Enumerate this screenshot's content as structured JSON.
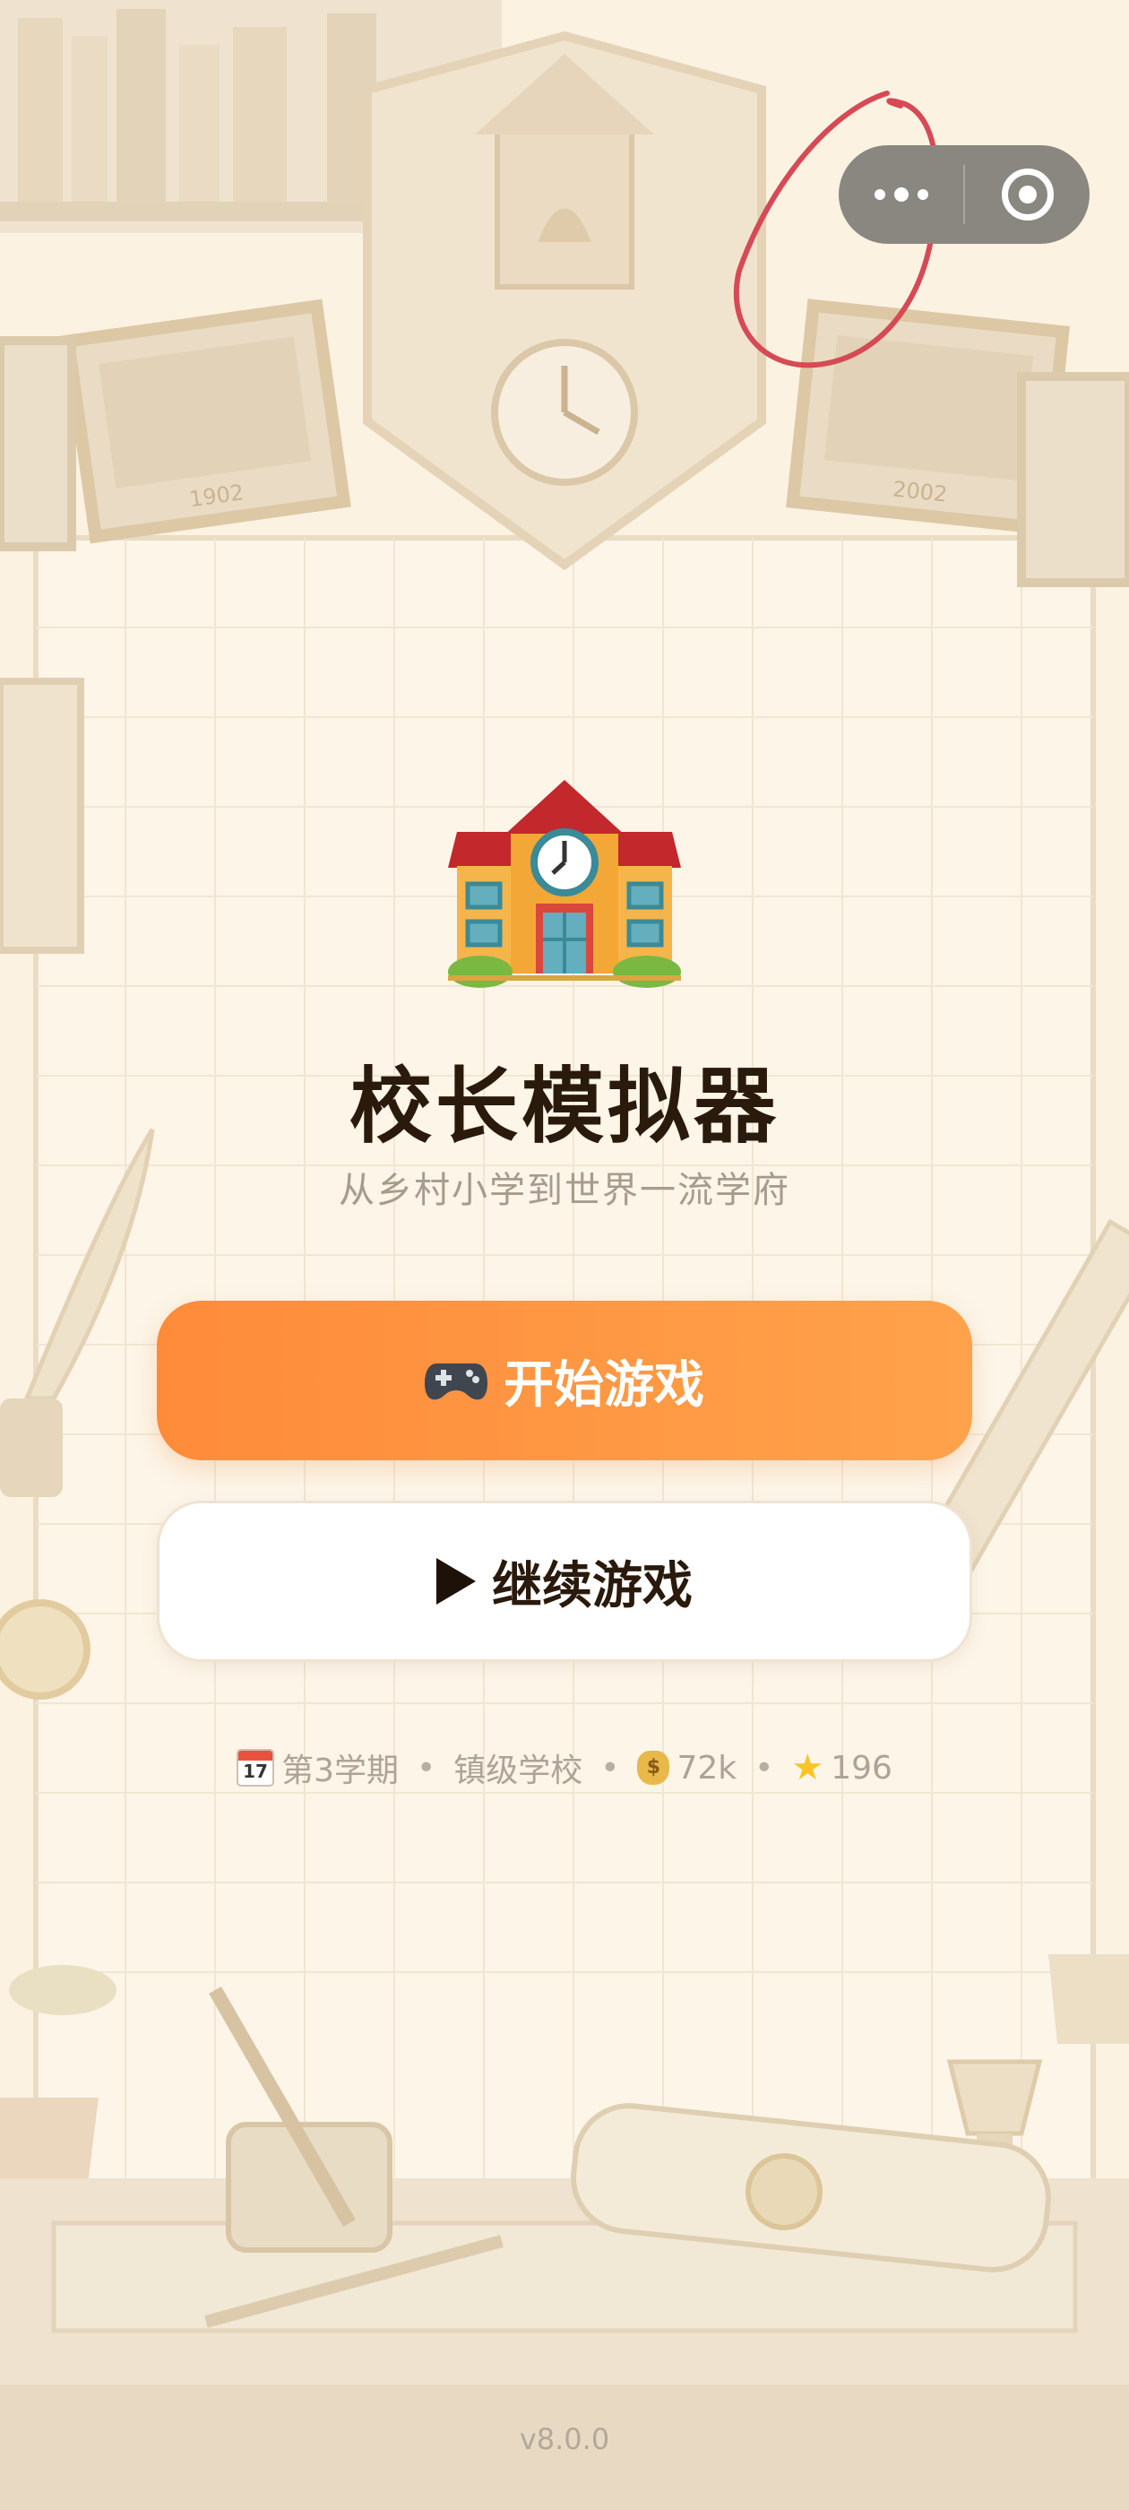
{
  "app": {
    "title": "校长模拟器",
    "subtitle": "从乡村小学到世界一流学府",
    "version": "v8.0.0"
  },
  "buttons": {
    "start_label": "开始游戏",
    "start_icon": "gamepad-icon",
    "continue_label": "继续游戏",
    "continue_icon": "play-icon"
  },
  "stats": {
    "calendar_day": "17",
    "term": "第3学期",
    "school_level": "镇级学校",
    "money": "72k",
    "stars": "196",
    "separator": "•"
  },
  "background": {
    "years": [
      "1902",
      "2002"
    ]
  },
  "colors": {
    "accent_start": "#fe8b3a",
    "accent_end": "#ffa24b",
    "title": "#2a1a0c",
    "background": "#fbf2e2"
  }
}
